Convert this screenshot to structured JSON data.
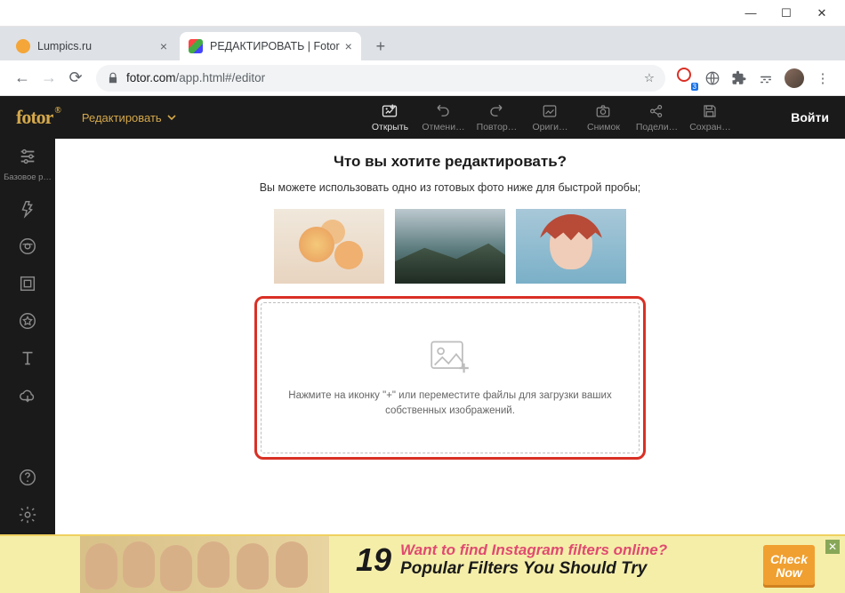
{
  "window": {
    "min": "—",
    "max": "☐",
    "close": "✕"
  },
  "tabs": [
    {
      "title": "Lumpics.ru",
      "favicon": "#f4a638"
    },
    {
      "title": "РЕДАКТИРОВАТЬ | Fotor",
      "favicon": "linear-gradient(135deg,#f44,#4a4,#44f)"
    }
  ],
  "newtab": "+",
  "addr": {
    "host": "fotor.com",
    "path": "/app.html#/editor",
    "star": "☆"
  },
  "ext_badge": "3",
  "app": {
    "logo": "fotor",
    "edit_label": "Редактировать",
    "login": "Войти"
  },
  "toolbar": [
    {
      "name": "open",
      "label": "Открыть"
    },
    {
      "name": "undo",
      "label": "Отмени…"
    },
    {
      "name": "redo",
      "label": "Повтор…"
    },
    {
      "name": "orig",
      "label": "Ориги…"
    },
    {
      "name": "snap",
      "label": "Снимок"
    },
    {
      "name": "share",
      "label": "Подели…"
    },
    {
      "name": "save",
      "label": "Сохран…"
    }
  ],
  "sidebar": {
    "first_label": "Базовое р…"
  },
  "main": {
    "title": "Что вы хотите редактировать?",
    "subtitle": "Вы можете использовать одно из готовых фото ниже для быстрой пробы;",
    "dz_text": "Нажмите на иконку \"+\" или переместите файлы для загрузки ваших собственных изображений."
  },
  "ad": {
    "num": "19",
    "line1": "Want to find Instagram filters online?",
    "line2": "Popular Filters You Should Try",
    "cta1": "Check",
    "cta2": "Now",
    "close": "✕"
  }
}
